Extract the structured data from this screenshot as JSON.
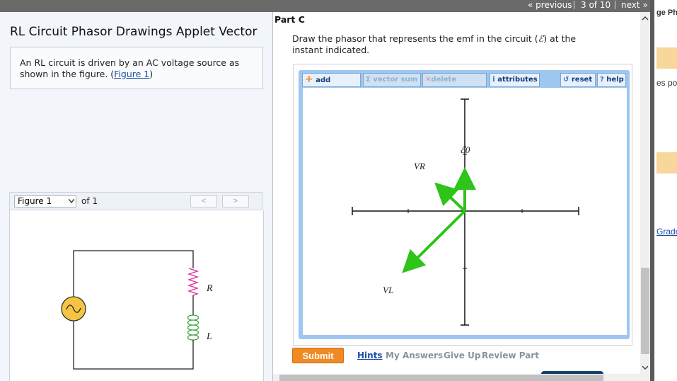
{
  "nav": {
    "previous": "« previous",
    "position": "3 of 10",
    "next": "next »"
  },
  "left": {
    "title": "RL Circuit Phasor Drawings Applet Vector",
    "description_text": "An RL circuit is driven by an AC voltage source as shown in the figure. (",
    "description_link": "Figure 1",
    "description_end": ")",
    "figure_select": "Figure 1",
    "figure_of": "of 1",
    "prev_glyph": "<",
    "next_glyph": ">",
    "circuit_labels": {
      "R": "R",
      "L": "L"
    }
  },
  "main": {
    "part": "Part C",
    "question_a": "Draw the phasor that represents the emf in the circuit (",
    "emf_symbol": "ℰ",
    "question_b": ") at the instant indicated.",
    "toolbar": {
      "add": "add element",
      "vector_sum": "vector sum",
      "delete": "delete element",
      "attributes": "attributes",
      "reset": "reset",
      "help": "help"
    },
    "phasor_labels": {
      "emf": "ℰ0",
      "VR": "VR",
      "VL": "VL"
    },
    "submit": "Submit",
    "links": {
      "hints": "Hints",
      "my_answers": "My Answers",
      "give_up": "Give Up",
      "review": "Review Part"
    }
  },
  "right_strip": {
    "text1": "ge Ph",
    "text2": "es po",
    "text3": "Grade"
  },
  "colors": {
    "phasor_green": "#2ec41a",
    "submit_orange": "#f08a24",
    "link_blue": "#1a4fa8"
  }
}
